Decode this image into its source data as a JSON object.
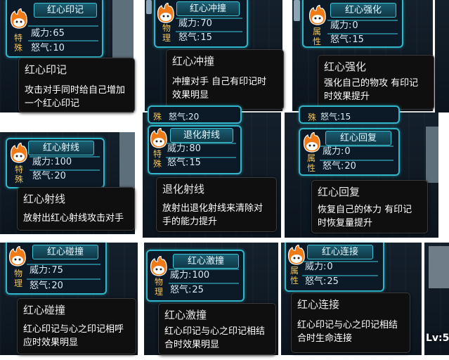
{
  "cards": [
    {
      "name": "红心印记",
      "type_tag": "特殊",
      "power_label": "威力:",
      "power": "65",
      "rage_label": "怒气:",
      "rage": "10",
      "tip_title": "红心印记",
      "tip_desc": "攻击对手同时给自己增加\n一个红心印记"
    },
    {
      "name": "红心冲撞",
      "type_tag": "物理",
      "power_label": "威力:",
      "power": "70",
      "rage_label": "怒气:",
      "rage": "15",
      "tip_title": "红心冲撞",
      "tip_desc": "冲撞对手 自己有印记时\n效果明显"
    },
    {
      "name": "红心强化",
      "type_tag": "属性",
      "power_label": "威力:",
      "power": "0",
      "rage_label": "怒气:",
      "rage": "15",
      "tip_title": "红心强化",
      "tip_desc": "强化自己的物攻 有印记\n时效果提升"
    },
    {
      "name": "红心射线",
      "type_tag": "特殊",
      "power_label": "威力:",
      "power": "100",
      "rage_label": "怒气:",
      "rage": "20",
      "tip_title": "红心射线",
      "tip_desc": "放射出红心射线攻击对手",
      "above_rage": ""
    },
    {
      "name": "退化射线",
      "type_tag": "特殊",
      "power_label": "威力:",
      "power": "80",
      "rage_label": "怒气:",
      "rage": "15",
      "tip_title": "退化射线",
      "tip_desc": "放射出退化射线来清除对\n手的能力提升",
      "above_rage": "怒气:20",
      "above_tag": "殊"
    },
    {
      "name": "红心回复",
      "type_tag": "属性",
      "power_label": "威力:",
      "power": "0",
      "rage_label": "怒气:",
      "rage": "20",
      "tip_title": "红心回复",
      "tip_desc": "恢复自己的体力 有印记\n时恢复量提升",
      "above_rage": "怒气:15",
      "above_tag": "殊"
    },
    {
      "name": "红心碰撞",
      "type_tag": "物理",
      "power_label": "威力:",
      "power": "75",
      "rage_label": "怒气:",
      "rage": "20",
      "tip_title": "红心碰撞",
      "tip_desc": "红心印记与心之印记相呼\n应时效果明显"
    },
    {
      "name": "红心激撞",
      "type_tag": "物理",
      "power_label": "威力:",
      "power": "100",
      "rage_label": "怒气:",
      "rage": "25",
      "tip_title": "红心激撞",
      "tip_desc": "红心印记与心之印记相结\n合时效果明显"
    },
    {
      "name": "红心连接",
      "type_tag": "属性",
      "power_label": "威力:",
      "power": "0",
      "rage_label": "怒气:",
      "rage": "25",
      "tip_title": "红心连接",
      "tip_desc": "红心印记与心之印记相结\n合时生命连接"
    }
  ],
  "corner_level": "Lv:5",
  "colors": {
    "card_border": "#2fb6c8",
    "tag": "#f2c35a",
    "tooltip_bg": "#0f0f0f"
  }
}
